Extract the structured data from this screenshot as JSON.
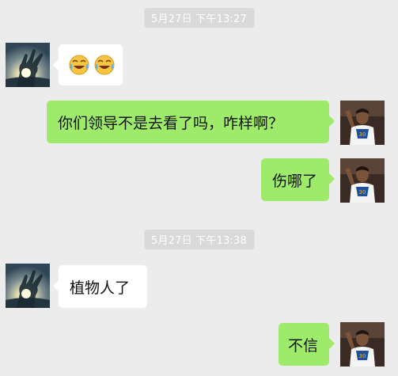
{
  "chat": {
    "timestamps": [
      "5月27日 下午13:27",
      "5月27日 下午13:38"
    ],
    "messages": [
      {
        "side": "left",
        "icons": [
          "laugh-cry-emoji",
          "laugh-cry-emoji"
        ]
      },
      {
        "side": "right",
        "text": "你们领导不是去看了吗，咋样啊？"
      },
      {
        "side": "right",
        "text": "伤哪了"
      },
      {
        "side": "left",
        "text": "植物人了"
      },
      {
        "side": "right",
        "text": "不信"
      }
    ]
  },
  "avatars": {
    "left": "ok-hand-sunset-avatar",
    "right": "basketball-player-avatar"
  },
  "colors": {
    "background": "#ececec",
    "timestamp_bg": "#d9d9d9",
    "sent_bubble": "#9eea6a",
    "received_bubble": "#ffffff"
  }
}
